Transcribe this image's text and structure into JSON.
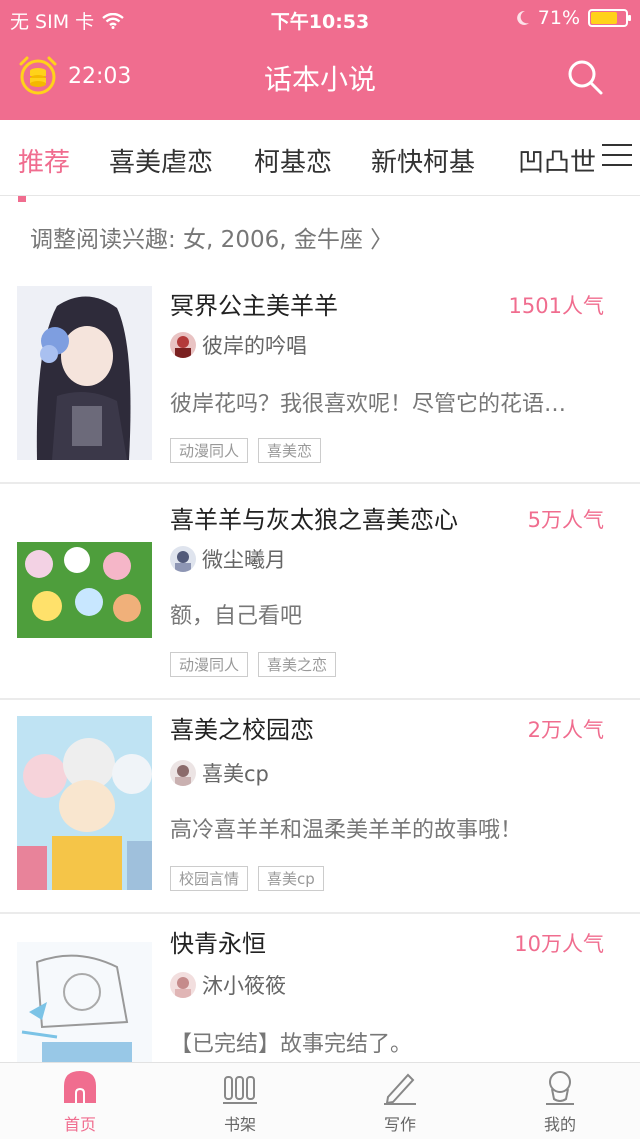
{
  "status_bar": {
    "carrier": "无 SIM 卡",
    "time": "下午10:53",
    "battery": "71%",
    "battery_level": 0.71
  },
  "header": {
    "timer": "22:03",
    "title": "话本小说"
  },
  "tabs": [
    {
      "label": "推荐"
    },
    {
      "label": "喜美虐恋"
    },
    {
      "label": "柯基恋"
    },
    {
      "label": "新快柯基"
    },
    {
      "label": "凹凸世"
    }
  ],
  "interest": {
    "text": "调整阅读兴趣: 女, 2006, 金牛座 〉"
  },
  "books": [
    {
      "title": "冥界公主美羊羊",
      "popularity": "1501人气",
      "author": "彼岸的吟唱",
      "desc": "彼岸花吗？我很喜欢呢！尽管它的花语…",
      "tags": [
        "动漫同人",
        "喜美恋"
      ]
    },
    {
      "title": "喜羊羊与灰太狼之喜美恋心",
      "popularity": "5万人气",
      "author": "微尘曦月",
      "desc": "额，自己看吧",
      "tags": [
        "动漫同人",
        "喜美之恋"
      ]
    },
    {
      "title": "喜美之校园恋",
      "popularity": "2万人气",
      "author": "喜美cp",
      "desc": "高冷喜羊羊和温柔美羊羊的故事哦！",
      "tags": [
        "校园言情",
        "喜美cp"
      ]
    },
    {
      "title": "快青永恒",
      "popularity": "10万人气",
      "author": "沐小筱筱",
      "desc": "【已完结】故事完结了。",
      "tags": []
    }
  ],
  "bottom_nav": [
    {
      "label": "首页",
      "icon": "home-icon"
    },
    {
      "label": "书架",
      "icon": "bookshelf-icon"
    },
    {
      "label": "写作",
      "icon": "pen-icon"
    },
    {
      "label": "我的",
      "icon": "profile-icon"
    }
  ],
  "colors": {
    "accent": "#f06d8f",
    "battery": "#ffd21a"
  }
}
